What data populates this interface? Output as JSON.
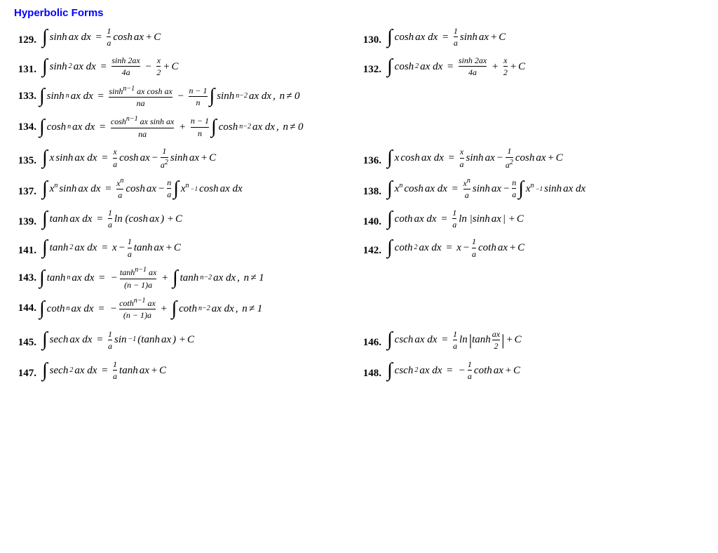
{
  "title": "Hyperbolic Forms",
  "formulas": {
    "129": "∫ sinh ax dx = (1/a) cosh ax + C",
    "130": "∫ cosh ax dx = (1/a) sinh ax + C"
  }
}
